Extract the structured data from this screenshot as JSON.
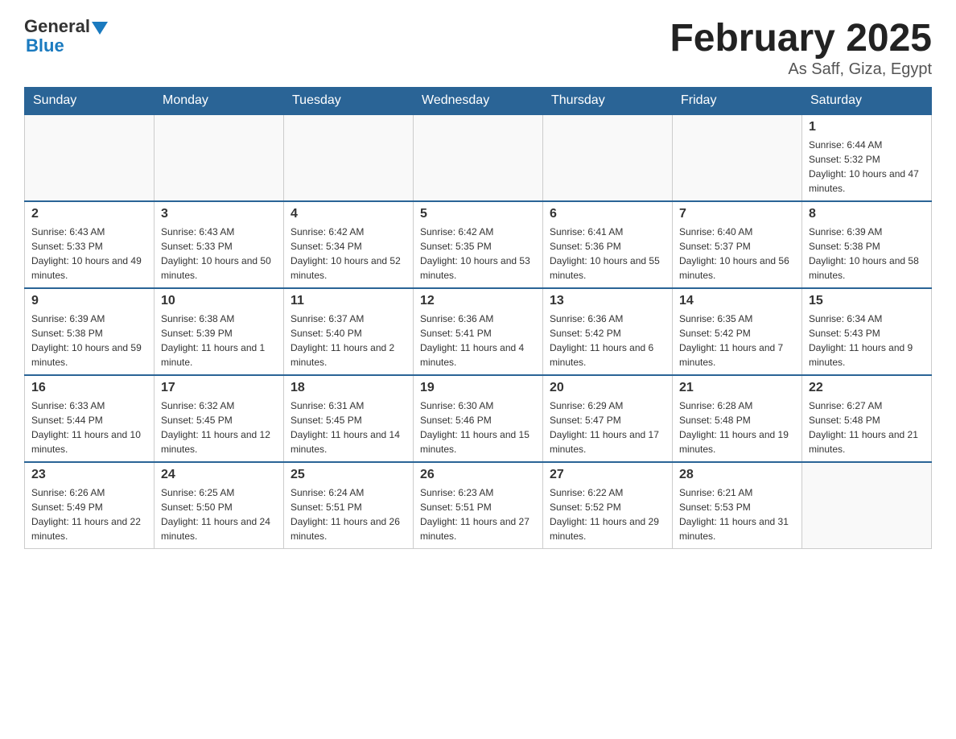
{
  "header": {
    "logo": {
      "general_text": "General",
      "blue_text": "Blue"
    },
    "title": "February 2025",
    "location": "As Saff, Giza, Egypt"
  },
  "days_of_week": [
    "Sunday",
    "Monday",
    "Tuesday",
    "Wednesday",
    "Thursday",
    "Friday",
    "Saturday"
  ],
  "weeks": [
    [
      {
        "day": "",
        "info": ""
      },
      {
        "day": "",
        "info": ""
      },
      {
        "day": "",
        "info": ""
      },
      {
        "day": "",
        "info": ""
      },
      {
        "day": "",
        "info": ""
      },
      {
        "day": "",
        "info": ""
      },
      {
        "day": "1",
        "info": "Sunrise: 6:44 AM\nSunset: 5:32 PM\nDaylight: 10 hours and 47 minutes."
      }
    ],
    [
      {
        "day": "2",
        "info": "Sunrise: 6:43 AM\nSunset: 5:33 PM\nDaylight: 10 hours and 49 minutes."
      },
      {
        "day": "3",
        "info": "Sunrise: 6:43 AM\nSunset: 5:33 PM\nDaylight: 10 hours and 50 minutes."
      },
      {
        "day": "4",
        "info": "Sunrise: 6:42 AM\nSunset: 5:34 PM\nDaylight: 10 hours and 52 minutes."
      },
      {
        "day": "5",
        "info": "Sunrise: 6:42 AM\nSunset: 5:35 PM\nDaylight: 10 hours and 53 minutes."
      },
      {
        "day": "6",
        "info": "Sunrise: 6:41 AM\nSunset: 5:36 PM\nDaylight: 10 hours and 55 minutes."
      },
      {
        "day": "7",
        "info": "Sunrise: 6:40 AM\nSunset: 5:37 PM\nDaylight: 10 hours and 56 minutes."
      },
      {
        "day": "8",
        "info": "Sunrise: 6:39 AM\nSunset: 5:38 PM\nDaylight: 10 hours and 58 minutes."
      }
    ],
    [
      {
        "day": "9",
        "info": "Sunrise: 6:39 AM\nSunset: 5:38 PM\nDaylight: 10 hours and 59 minutes."
      },
      {
        "day": "10",
        "info": "Sunrise: 6:38 AM\nSunset: 5:39 PM\nDaylight: 11 hours and 1 minute."
      },
      {
        "day": "11",
        "info": "Sunrise: 6:37 AM\nSunset: 5:40 PM\nDaylight: 11 hours and 2 minutes."
      },
      {
        "day": "12",
        "info": "Sunrise: 6:36 AM\nSunset: 5:41 PM\nDaylight: 11 hours and 4 minutes."
      },
      {
        "day": "13",
        "info": "Sunrise: 6:36 AM\nSunset: 5:42 PM\nDaylight: 11 hours and 6 minutes."
      },
      {
        "day": "14",
        "info": "Sunrise: 6:35 AM\nSunset: 5:42 PM\nDaylight: 11 hours and 7 minutes."
      },
      {
        "day": "15",
        "info": "Sunrise: 6:34 AM\nSunset: 5:43 PM\nDaylight: 11 hours and 9 minutes."
      }
    ],
    [
      {
        "day": "16",
        "info": "Sunrise: 6:33 AM\nSunset: 5:44 PM\nDaylight: 11 hours and 10 minutes."
      },
      {
        "day": "17",
        "info": "Sunrise: 6:32 AM\nSunset: 5:45 PM\nDaylight: 11 hours and 12 minutes."
      },
      {
        "day": "18",
        "info": "Sunrise: 6:31 AM\nSunset: 5:45 PM\nDaylight: 11 hours and 14 minutes."
      },
      {
        "day": "19",
        "info": "Sunrise: 6:30 AM\nSunset: 5:46 PM\nDaylight: 11 hours and 15 minutes."
      },
      {
        "day": "20",
        "info": "Sunrise: 6:29 AM\nSunset: 5:47 PM\nDaylight: 11 hours and 17 minutes."
      },
      {
        "day": "21",
        "info": "Sunrise: 6:28 AM\nSunset: 5:48 PM\nDaylight: 11 hours and 19 minutes."
      },
      {
        "day": "22",
        "info": "Sunrise: 6:27 AM\nSunset: 5:48 PM\nDaylight: 11 hours and 21 minutes."
      }
    ],
    [
      {
        "day": "23",
        "info": "Sunrise: 6:26 AM\nSunset: 5:49 PM\nDaylight: 11 hours and 22 minutes."
      },
      {
        "day": "24",
        "info": "Sunrise: 6:25 AM\nSunset: 5:50 PM\nDaylight: 11 hours and 24 minutes."
      },
      {
        "day": "25",
        "info": "Sunrise: 6:24 AM\nSunset: 5:51 PM\nDaylight: 11 hours and 26 minutes."
      },
      {
        "day": "26",
        "info": "Sunrise: 6:23 AM\nSunset: 5:51 PM\nDaylight: 11 hours and 27 minutes."
      },
      {
        "day": "27",
        "info": "Sunrise: 6:22 AM\nSunset: 5:52 PM\nDaylight: 11 hours and 29 minutes."
      },
      {
        "day": "28",
        "info": "Sunrise: 6:21 AM\nSunset: 5:53 PM\nDaylight: 11 hours and 31 minutes."
      },
      {
        "day": "",
        "info": ""
      }
    ]
  ]
}
